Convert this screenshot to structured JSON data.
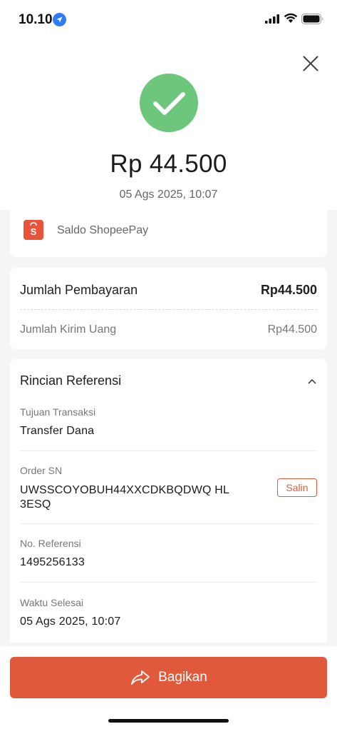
{
  "status_bar": {
    "time": "10.10"
  },
  "header": {
    "amount": "Rp 44.500",
    "datetime": "05 Ags 2025, 10:07"
  },
  "payment_method": {
    "label": "Saldo ShopeePay"
  },
  "payment_summary": {
    "total_label": "Jumlah Pembayaran",
    "total_value": "Rp44.500",
    "send_label": "Jumlah Kirim Uang",
    "send_value": "Rp44.500"
  },
  "reference": {
    "title": "Rincian Referensi",
    "purpose_label": "Tujuan Transaksi",
    "purpose_value": "Transfer Dana",
    "order_sn_label": "Order SN",
    "order_sn_value": "UWSSCOYOBUH44XXCDKBQDWQ HL3ESQ",
    "copy_label": "Salin",
    "ref_no_label": "No. Referensi",
    "ref_no_value": "1495256133",
    "finish_label": "Waktu Selesai",
    "finish_value": "05 Ags 2025, 10:07"
  },
  "footer": {
    "share_label": "Bagikan"
  },
  "colors": {
    "success": "#6cc77d",
    "accent": "#e0593a",
    "shopee": "#e8533a"
  }
}
